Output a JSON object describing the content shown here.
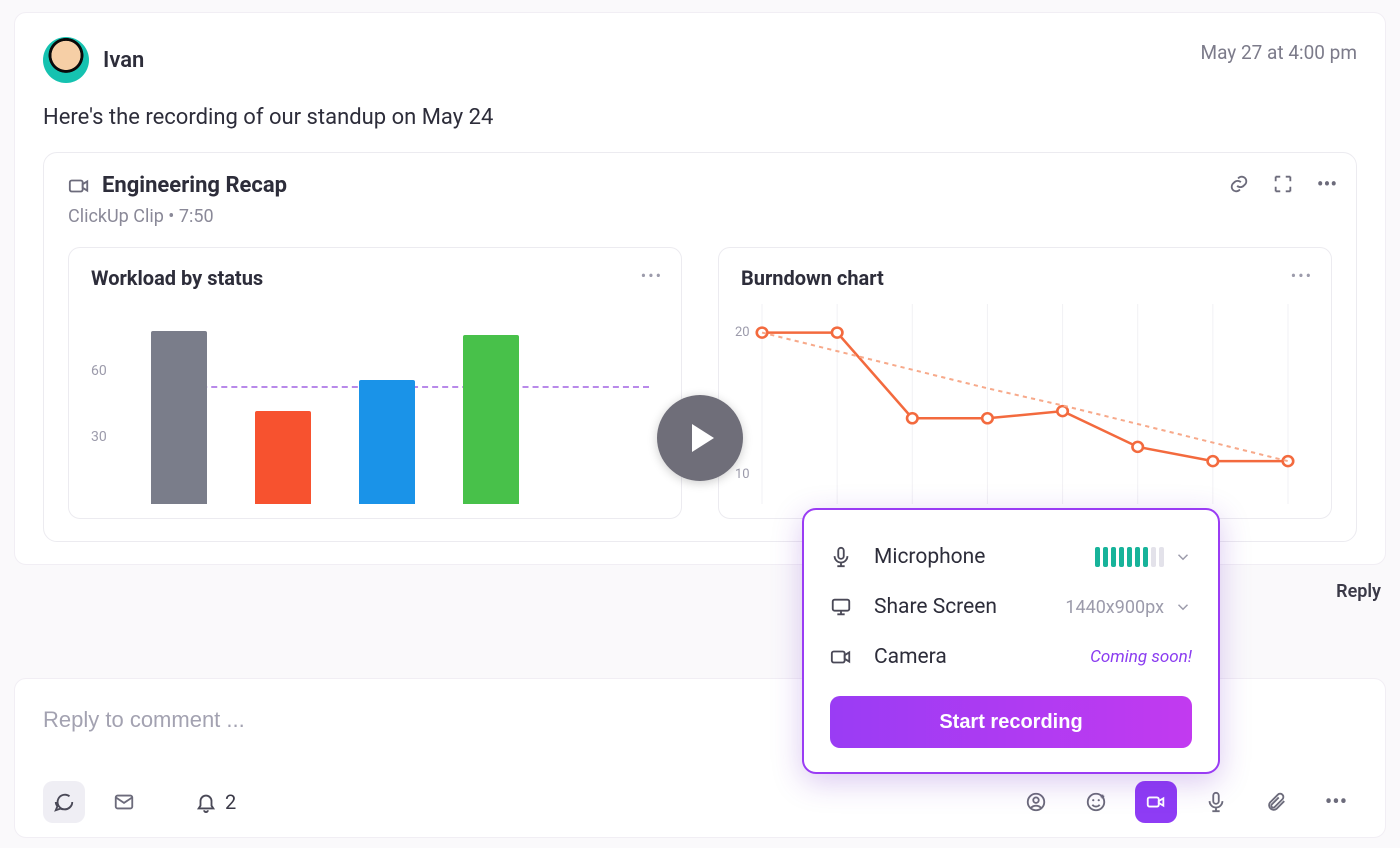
{
  "comment": {
    "author": "Ivan",
    "timestamp": "May 27 at 4:00 pm",
    "body": "Here's the recording of our standup on May 24"
  },
  "clip": {
    "title": "Engineering Recap",
    "source": "ClickUp Clip",
    "duration": "7:50"
  },
  "panel1_title": "Workload by status",
  "panel2_title": "Burndown chart",
  "recorder": {
    "mic_label": "Microphone",
    "share_label": "Share Screen",
    "share_value": "1440x900px",
    "camera_label": "Camera",
    "camera_note": "Coming soon!",
    "start_label": "Start recording",
    "mic_level": {
      "active": 7,
      "total": 9
    }
  },
  "reply_link": "Reply",
  "composer": {
    "placeholder": "Reply to comment ...",
    "notif_count": "2"
  },
  "chart_data": [
    {
      "type": "bar",
      "title": "Workload by status",
      "categories": [
        "gray",
        "red",
        "blue",
        "green"
      ],
      "values": [
        78,
        42,
        56,
        76
      ],
      "colors": [
        "#7a7d8a",
        "#f7522f",
        "#1a93e8",
        "#48c14a"
      ],
      "ylim": [
        0,
        90
      ],
      "yticks": [
        30,
        60
      ],
      "reference_line": 52
    },
    {
      "type": "line",
      "title": "Burndown chart",
      "x": [
        0,
        1,
        2,
        3,
        4,
        5,
        6,
        7
      ],
      "series": [
        {
          "name": "actual",
          "values": [
            20,
            20,
            14,
            14,
            14.5,
            12,
            11,
            11
          ],
          "style": "solid"
        },
        {
          "name": "ideal",
          "values": [
            20,
            18.7,
            17.4,
            16.1,
            14.9,
            13.6,
            12.3,
            11
          ],
          "style": "dashed"
        }
      ],
      "yticks": [
        10,
        20
      ],
      "ylim": [
        8,
        22
      ]
    }
  ]
}
